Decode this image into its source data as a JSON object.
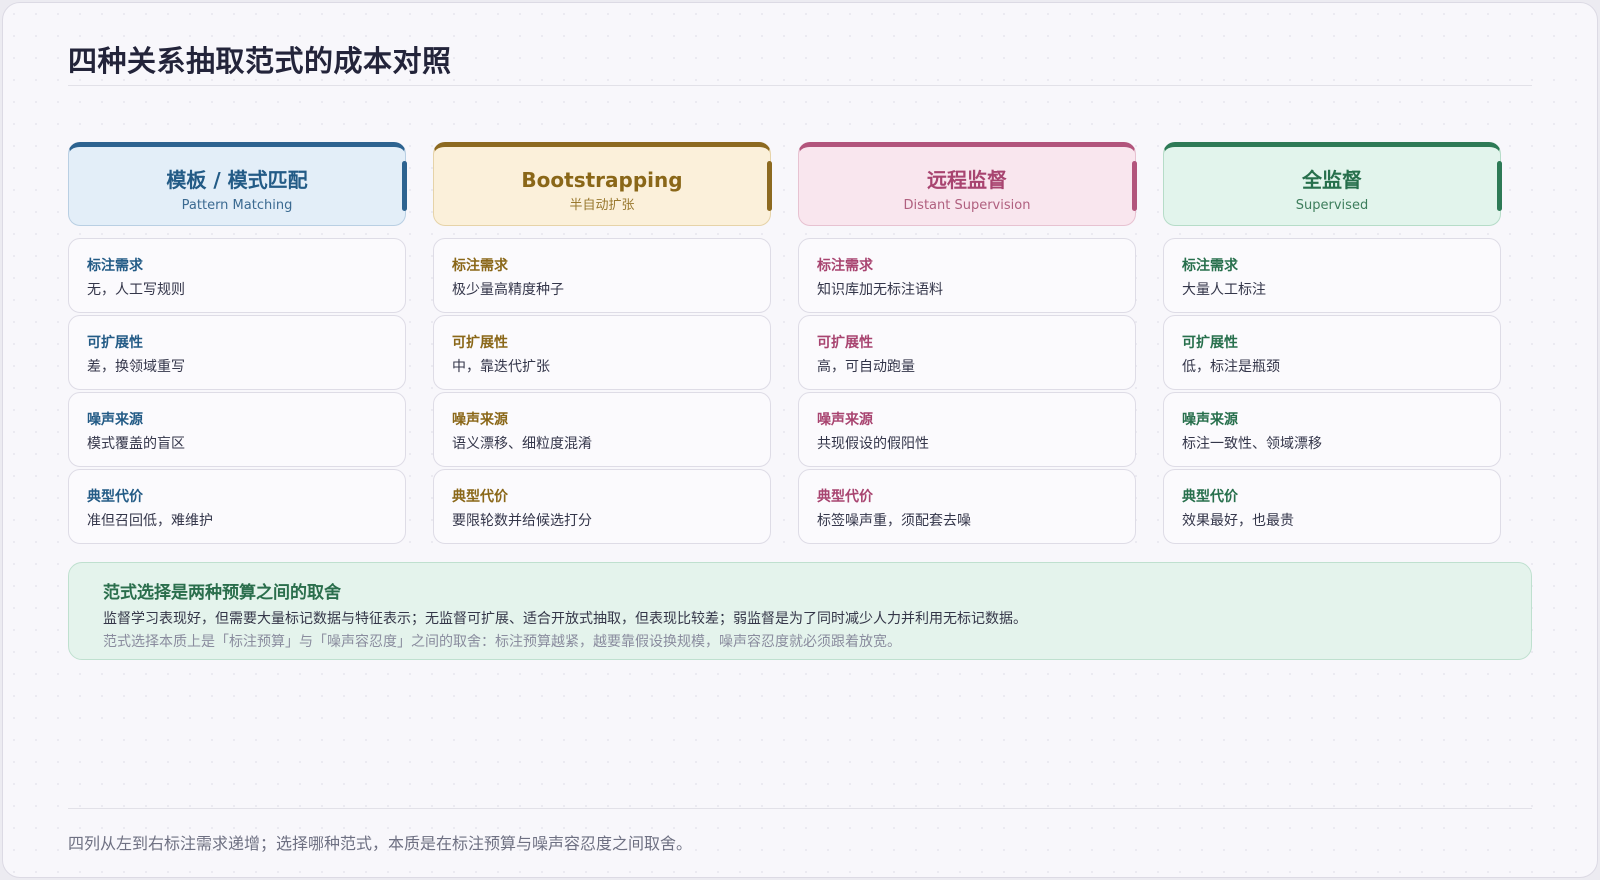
{
  "title": "四种关系抽取范式的成本对照",
  "columns": [
    {
      "title": "模板 / 模式匹配",
      "subtitle": "Pattern Matching",
      "rows": [
        {
          "label": "标注需求",
          "value": "无，人工写规则"
        },
        {
          "label": "可扩展性",
          "value": "差，换领域重写"
        },
        {
          "label": "噪声来源",
          "value": "模式覆盖的盲区"
        },
        {
          "label": "典型代价",
          "value": "准但召回低，难维护"
        }
      ]
    },
    {
      "title": "Bootstrapping",
      "subtitle": "半自动扩张",
      "rows": [
        {
          "label": "标注需求",
          "value": "极少量高精度种子"
        },
        {
          "label": "可扩展性",
          "value": "中，靠迭代扩张"
        },
        {
          "label": "噪声来源",
          "value": "语义漂移、细粒度混淆"
        },
        {
          "label": "典型代价",
          "value": "要限轮数并给候选打分"
        }
      ]
    },
    {
      "title": "远程监督",
      "subtitle": "Distant Supervision",
      "rows": [
        {
          "label": "标注需求",
          "value": "知识库加无标注语料"
        },
        {
          "label": "可扩展性",
          "value": "高，可自动跑量"
        },
        {
          "label": "噪声来源",
          "value": "共现假设的假阳性"
        },
        {
          "label": "典型代价",
          "value": "标签噪声重，须配套去噪"
        }
      ]
    },
    {
      "title": "全监督",
      "subtitle": "Supervised",
      "rows": [
        {
          "label": "标注需求",
          "value": "大量人工标注"
        },
        {
          "label": "可扩展性",
          "value": "低，标注是瓶颈"
        },
        {
          "label": "噪声来源",
          "value": "标注一致性、领域漂移"
        },
        {
          "label": "典型代价",
          "value": "效果最好，也最贵"
        }
      ]
    }
  ],
  "summary": {
    "title": "范式选择是两种预算之间的取舍",
    "line1": "监督学习表现好，但需要大量标记数据与特征表示；无监督可扩展、适合开放式抽取，但表现比较差；弱监督是为了同时减少人力并利用无标记数据。",
    "line2": "范式选择本质上是「标注预算」与「噪声容忍度」之间的取舍：标注预算越紧，越要靠假设换规模，噪声容忍度就必须跟着放宽。"
  },
  "footer": "四列从左到右标注需求递增；选择哪种范式，本质是在标注预算与噪声容忍度之间取舍。",
  "colors": {
    "pattern": "#2d6390",
    "bootstrapping": "#8d6a20",
    "distant": "#b2557c",
    "supervised": "#2e7a56"
  }
}
